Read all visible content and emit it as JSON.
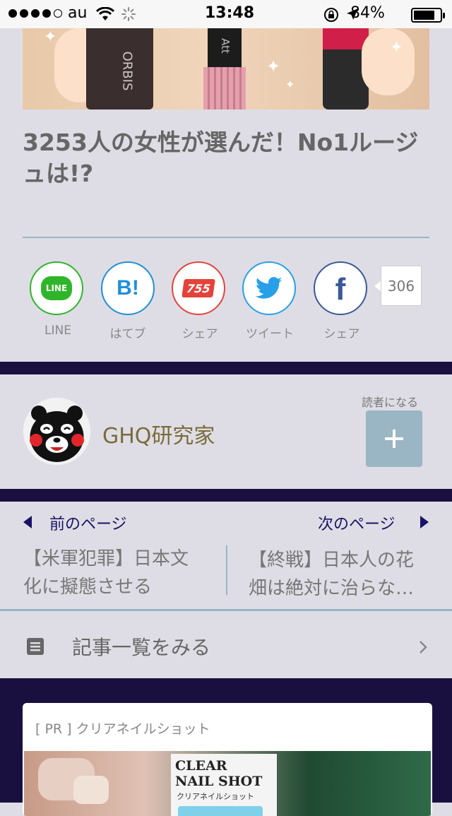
{
  "status_bar": {
    "carrier": "au",
    "time": "13:48",
    "battery": "84%",
    "battery_level": 0.84
  },
  "hero": {
    "brand_text_1": "ORBIS",
    "brand_text_2": "Att"
  },
  "article": {
    "title": "3253人の女性が選んだ！No1ルージュは!?"
  },
  "share": {
    "buttons": [
      {
        "label": "LINE",
        "icon": "line-icon",
        "color": "#2fb52a"
      },
      {
        "label": "はてブ",
        "icon": "hatena-bookmark-icon",
        "color": "#1d8fdc"
      },
      {
        "label": "シェア",
        "icon": "755-icon",
        "color": "#e4433b"
      },
      {
        "label": "ツイート",
        "icon": "twitter-bird-icon",
        "color": "#27a0e8"
      },
      {
        "label": "シェア",
        "icon": "facebook-icon",
        "color": "#3b5998"
      }
    ],
    "line_text": "LINE",
    "hatena_text": "B!",
    "seven_text": "755",
    "fb_text": "f",
    "count": "306"
  },
  "reader": {
    "author": "GHQ研究家",
    "follow_label": "読者になる",
    "follow_icon": "plus-icon"
  },
  "pager": {
    "prev_label": "前のページ",
    "next_label": "次のページ",
    "prev_title_1": "【米軍犯罪】日本文",
    "prev_title_2": "化に擬態させる",
    "next_title_1": "【終戦】日本人の花",
    "next_title_2": "畑は絶対に治らな…"
  },
  "article_list": {
    "label": "記事一覧をみる"
  },
  "ad": {
    "label": "[ PR ] クリアネイルショット",
    "bottle_text_1": "CLEAR",
    "bottle_text_2": "NAIL SHOT",
    "bottle_text_3": "クリアネイルショット"
  }
}
